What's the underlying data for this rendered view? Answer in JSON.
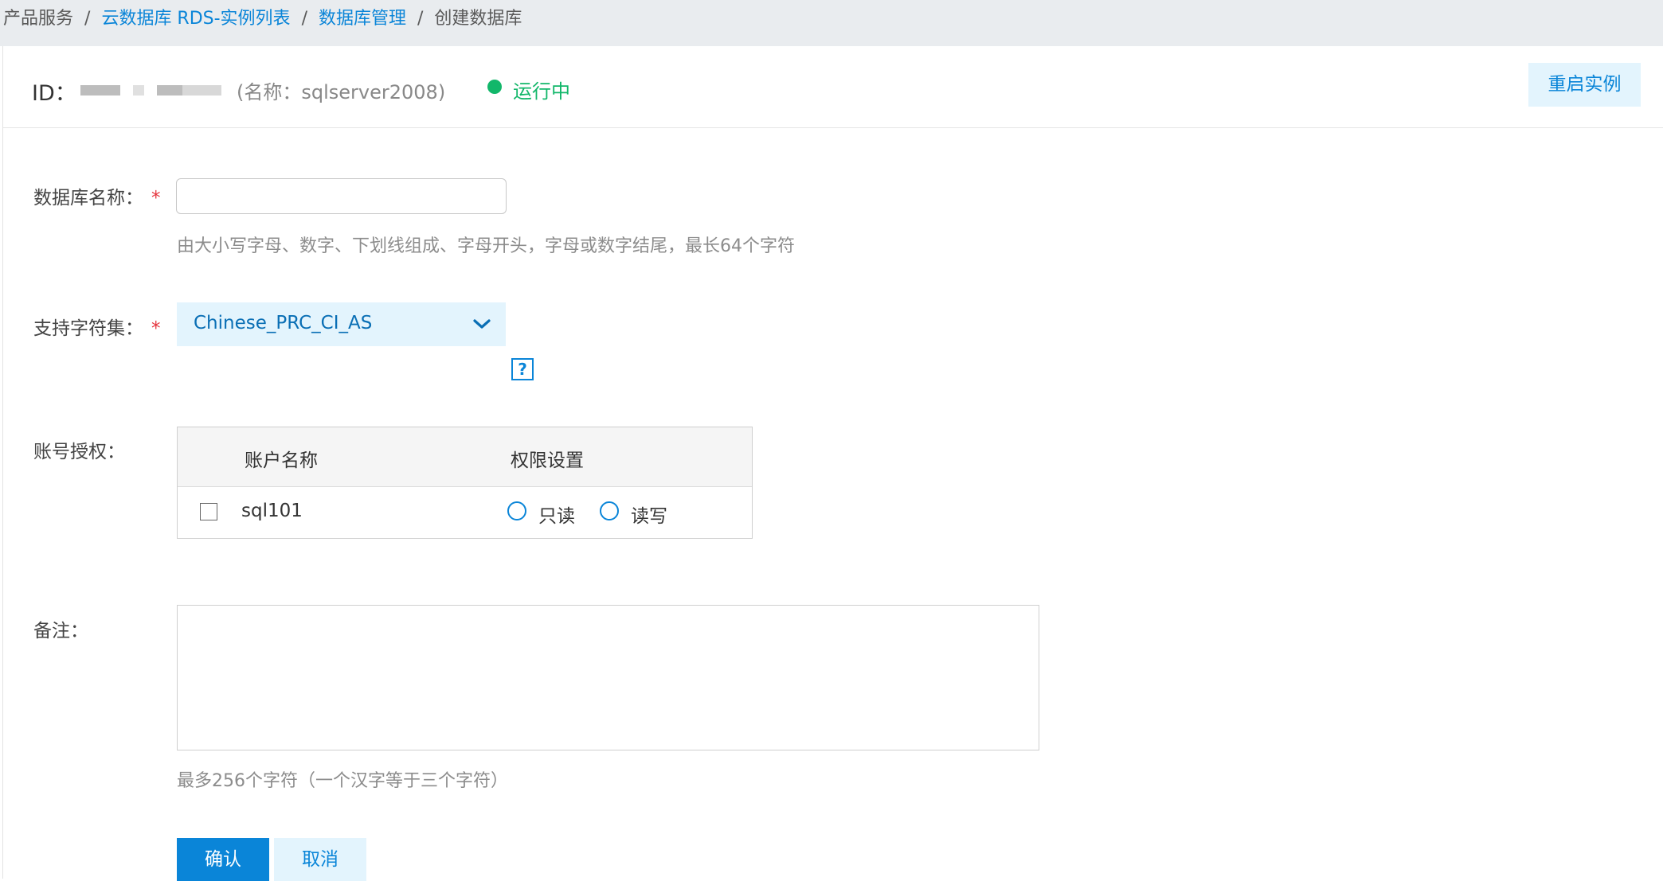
{
  "breadcrumb": {
    "items": [
      "产品服务",
      "云数据库 RDS-实例列表",
      "数据库管理",
      "创建数据库"
    ],
    "separator": "/"
  },
  "instance": {
    "id_label": "ID：",
    "alias": "(名称：sqlserver2008)",
    "status": "运行中",
    "status_color": "#12b76a",
    "restart_label": "重启实例"
  },
  "form": {
    "db_name_label": "数据库名称：",
    "required_mark": "*",
    "db_name_value": "",
    "db_name_hint": "由大小写字母、数字、下划线组成、字母开头，字母或数字结尾，最长64个字符",
    "charset_label": "支持字符集：",
    "charset_value": "Chinese_PRC_CI_AS",
    "help_glyph": "?",
    "account_label": "账号授权：",
    "accounts": {
      "headers": [
        "账户名称",
        "权限设置"
      ],
      "rows": [
        {
          "name": "sql101",
          "checked": false,
          "options": [
            "只读",
            "读写"
          ]
        }
      ]
    },
    "remark_label": "备注：",
    "remark_value": "",
    "remark_hint": "最多256个字符（一个汉字等于三个字符）",
    "confirm_label": "确认",
    "cancel_label": "取消"
  },
  "colors": {
    "accent": "#0a85d8",
    "accent_light": "#e3f4fd",
    "required": "#e5353e",
    "topbar": "#e9ecef"
  }
}
